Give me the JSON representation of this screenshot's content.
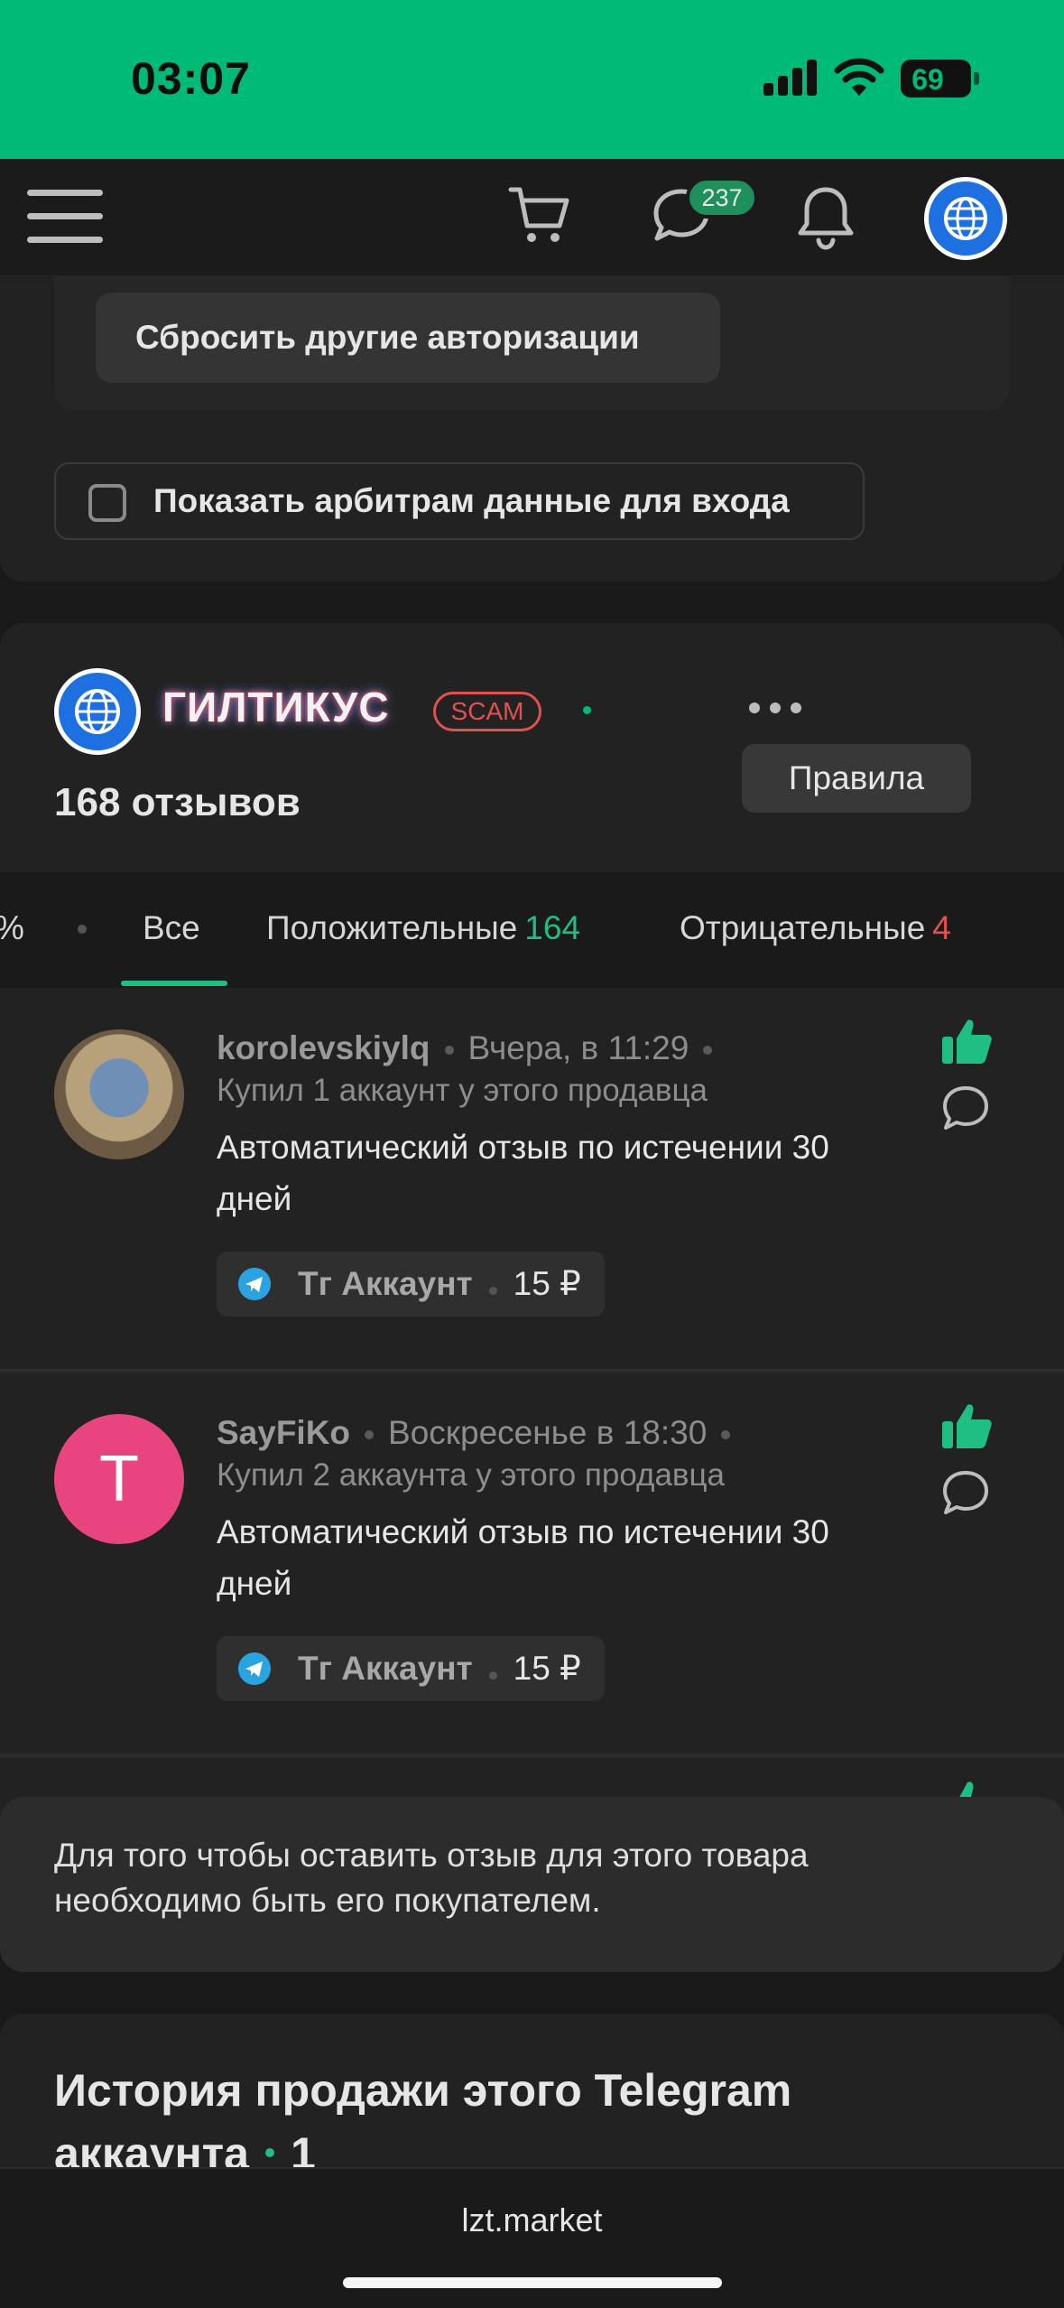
{
  "status_bar": {
    "time": "03:07",
    "battery": "69"
  },
  "top_nav": {
    "chat_badge": "237"
  },
  "account_settings": {
    "reset_button": "Сбросить другие авторизации",
    "arbitrator_checkbox_label": "Показать арбитрам данные для входа",
    "arbitrator_checked": false
  },
  "seller": {
    "name": "ГИЛТИКУС",
    "scam_badge": "SCAM",
    "rules_button": "Правила",
    "review_count": "168 отзывов"
  },
  "tabs": [
    {
      "label": "% "
    },
    {
      "label": "Все",
      "active": true
    },
    {
      "label": "Положительные",
      "count": "164"
    },
    {
      "label": "Отрицательные",
      "count": "4"
    }
  ],
  "reviews": [
    {
      "user": "korolevskiylq",
      "date": "Вчера, в 11:29",
      "purchase": "Купил 1 аккаунт у этого продавца",
      "text": "Автоматический отзыв по истечении 30 дней",
      "tag_label": "Тг Аккаунт",
      "tag_price": "15 ₽",
      "avatar_icon": "stitch-avatar-icon"
    },
    {
      "user": "SayFiKo",
      "date": "Воскресенье в 18:30",
      "purchase": "Купил 2 аккаунта у этого продавца",
      "text": "Автоматический отзыв по истечении 30 дней",
      "tag_label": "Тг Аккаунт",
      "tag_price": "15 ₽",
      "avatar_letter": "T"
    }
  ],
  "review_notice": "Для того чтобы оставить отзыв для этого товара необходимо быть его покупателем.",
  "history": {
    "title": "История продажи этого Telegram аккаунта",
    "count": "1"
  },
  "browser": {
    "domain": "lzt.market"
  },
  "colors": {
    "accent": "#00ba78",
    "danger": "#e0524f",
    "background": "#191919",
    "card": "#222222"
  }
}
